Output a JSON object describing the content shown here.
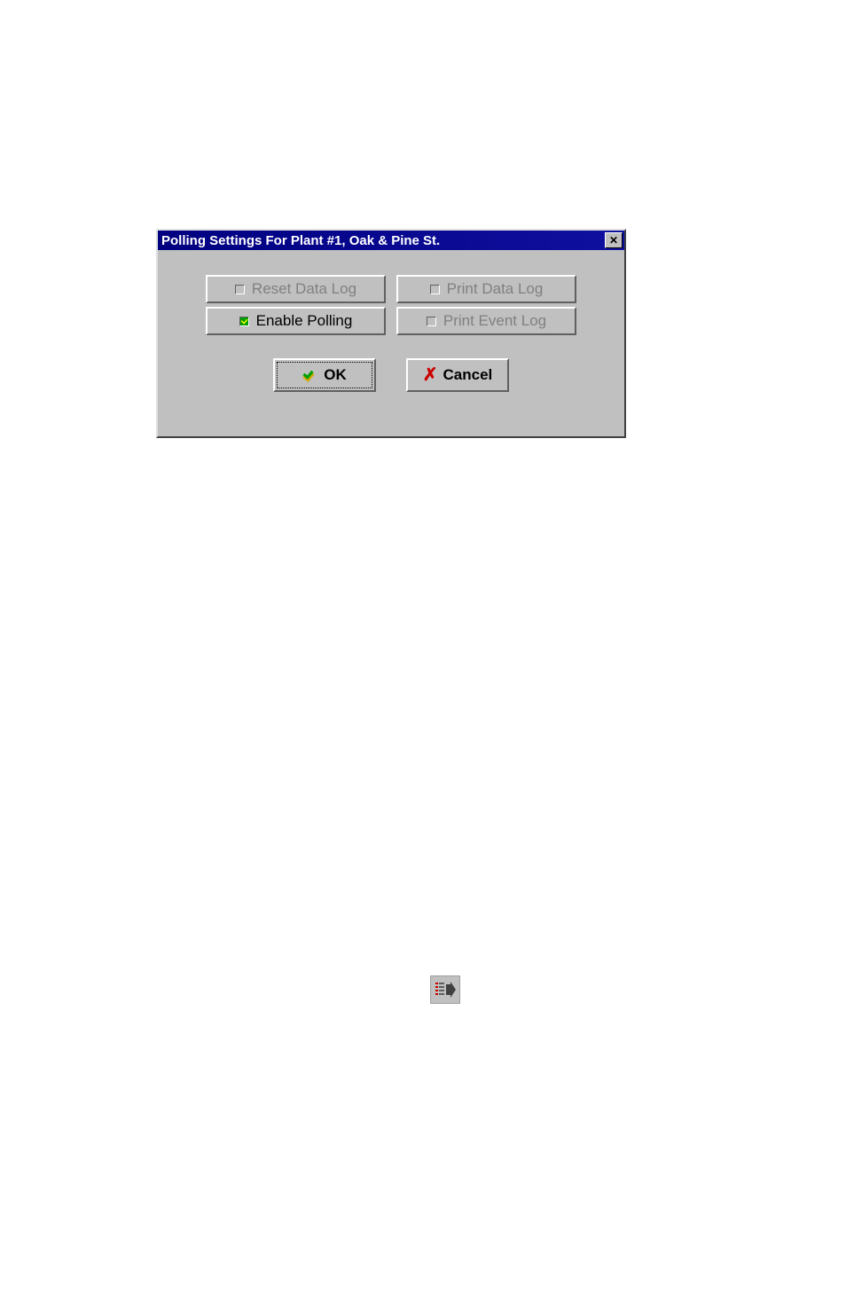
{
  "dialog": {
    "title": "Polling Settings For Plant #1, Oak & Pine St.",
    "options": {
      "reset_data_log": {
        "label": "Reset Data Log",
        "checked": false
      },
      "print_data_log": {
        "label": "Print Data Log",
        "checked": false
      },
      "enable_polling": {
        "label": "Enable Polling",
        "checked": true
      },
      "print_event_log": {
        "label": "Print Event Log",
        "checked": false
      }
    },
    "actions": {
      "ok": "OK",
      "cancel": "Cancel"
    }
  }
}
